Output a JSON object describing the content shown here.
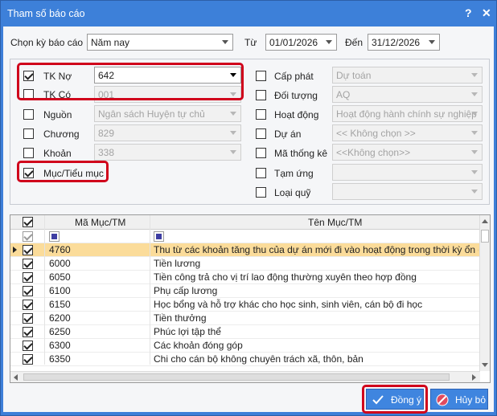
{
  "window": {
    "title": "Tham số báo cáo",
    "help_glyph": "?",
    "close_glyph": "✕"
  },
  "period": {
    "label": "Chọn kỳ báo cáo",
    "value": "Năm nay",
    "from_label": "Từ",
    "from_value": "01/01/2026",
    "to_label": "Đến",
    "to_value": "31/12/2026"
  },
  "left_filters": [
    {
      "label": "TK Nợ",
      "checked": true,
      "value": "642",
      "enabled": true
    },
    {
      "label": "TK Có",
      "checked": false,
      "value": "001",
      "enabled": false
    },
    {
      "label": "Nguồn",
      "checked": false,
      "value": "Ngân sách Huyện tự chủ",
      "enabled": false
    },
    {
      "label": "Chương",
      "checked": false,
      "value": "829",
      "enabled": false
    },
    {
      "label": "Khoản",
      "checked": false,
      "value": "338",
      "enabled": false
    },
    {
      "label": "Mục/Tiểu mục",
      "checked": true
    }
  ],
  "right_filters": [
    {
      "label": "Cấp phát",
      "value": "Dự toán"
    },
    {
      "label": "Đối tượng",
      "value": "AQ"
    },
    {
      "label": "Hoạt động",
      "value": "Hoạt động hành chính sự nghiệp"
    },
    {
      "label": "Dự án",
      "value": "<< Không chọn >>"
    },
    {
      "label": "Mã thống kê",
      "value": "<<Không chọn>>"
    },
    {
      "label": "Tạm ứng",
      "value": ""
    },
    {
      "label": "Loại quỹ",
      "value": ""
    }
  ],
  "grid": {
    "col_code": "Mã Mục/TM",
    "col_name": "Tên Mục/TM",
    "rows": [
      {
        "code": "4760",
        "name": "Thu từ các khoản tăng thu của dự án mới đi vào hoạt động trong thời kỳ ổn định n",
        "checked": true,
        "selected": true
      },
      {
        "code": "6000",
        "name": "Tiền lương",
        "checked": true
      },
      {
        "code": "6050",
        "name": "Tiền công trả cho vị trí lao động thường xuyên theo hợp đồng",
        "checked": true
      },
      {
        "code": "6100",
        "name": "Phụ cấp lương",
        "checked": true
      },
      {
        "code": "6150",
        "name": "Học bổng và hỗ trợ khác cho học sinh, sinh viên, cán bộ đi học",
        "checked": true
      },
      {
        "code": "6200",
        "name": "Tiền thưởng",
        "checked": true
      },
      {
        "code": "6250",
        "name": "Phúc lợi tập thể",
        "checked": true
      },
      {
        "code": "6300",
        "name": "Các khoản đóng góp",
        "checked": true
      },
      {
        "code": "6350",
        "name": "Chi cho cán bộ không chuyên trách xã, thôn, bản",
        "checked": true
      }
    ]
  },
  "buttons": {
    "ok": "Đồng ý",
    "cancel": "Hủy bỏ"
  },
  "colors": {
    "titlebar": "#3d80d9",
    "highlight": "#d0021b",
    "selected_row": "#fbdc9a"
  },
  "icons": {
    "ok": "check-icon",
    "cancel": "cancel-icon"
  }
}
